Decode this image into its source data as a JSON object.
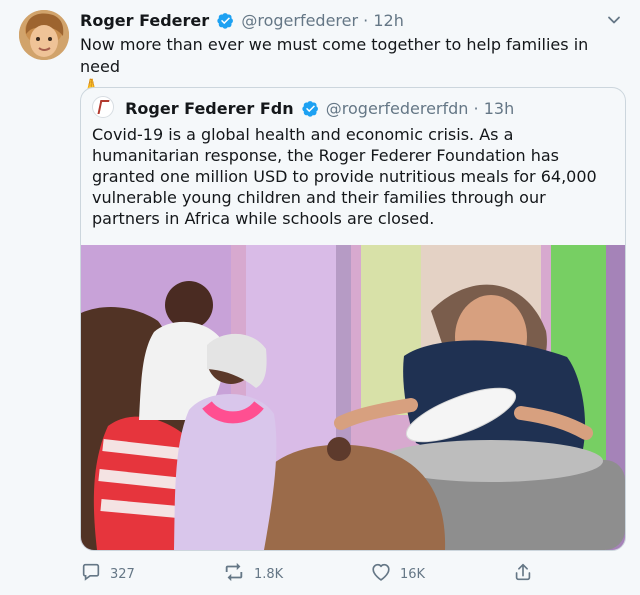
{
  "tweet": {
    "author_name": "Roger Federer",
    "handle": "@rogerfederer",
    "separator": "·",
    "time": "12h",
    "text": "Now more than ever we must come together to help families in need",
    "emoji": "🙏"
  },
  "quoted_tweet": {
    "author_name": "Roger Federer Fdn",
    "handle": "@rogerfedererfdn",
    "separator": "·",
    "time": "13h",
    "text": "Covid-19 is a global health and economic crisis. As a humanitarian response, the Roger Federer Foundation has granted one million USD to provide nutritious meals for 64,000 vulnerable young children and their families through our partners in Africa while schools are closed."
  },
  "actions": {
    "reply_count": "327",
    "retweet_count": "1.8K",
    "like_count": "16K"
  },
  "icons": {
    "verified": "verified-badge-icon",
    "menu": "chevron-down-icon",
    "reply": "reply-icon",
    "retweet": "retweet-icon",
    "like": "heart-icon",
    "share": "share-icon"
  },
  "colors": {
    "background": "#f5f8fa",
    "text": "#14171a",
    "secondary": "#657786",
    "verified": "#1da1f2",
    "border": "#ccd6dd"
  }
}
